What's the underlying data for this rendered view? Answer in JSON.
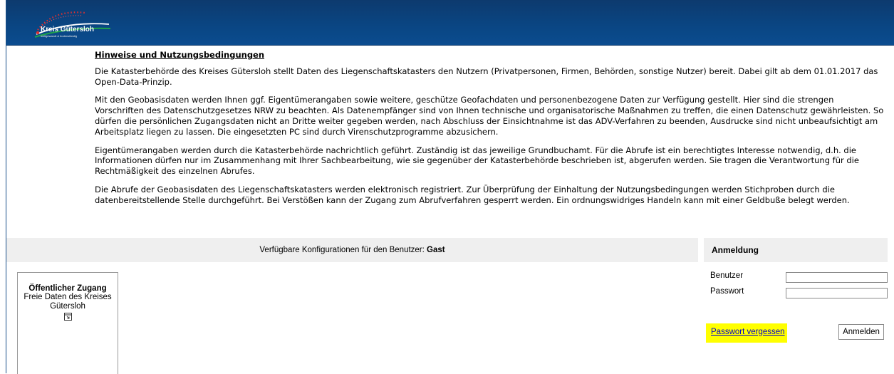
{
  "header": {
    "logo_name": "Kreis Gütersloh",
    "logo_tagline": "weltgewandt & bodenständig",
    "background_color": "#0b4a8c"
  },
  "terms": {
    "title": "Hinweise und Nutzungsbedingungen",
    "paragraphs": [
      "Die Katasterbehörde des Kreises Gütersloh stellt Daten des Liegenschaftskatasters den Nutzern (Privatpersonen, Firmen, Behörden, sonstige Nutzer) bereit. Dabei gilt ab dem 01.01.2017 das Open-Data-Prinzip.",
      "Mit den Geobasisdaten werden Ihnen ggf. Eigentümerangaben sowie weitere, geschütze Geofachdaten und personenbezogene Daten zur Verfügung gestellt. Hier sind die strengen Vorschriften des Datenschutzgesetzes NRW zu beachten. Als Datenempfänger sind von Ihnen technische und organisatorische Maßnahmen zu treffen, die einen Datenschutz gewährleisten. So dürfen die persönlichen Zugangsdaten nicht an Dritte weiter gegeben werden, nach Abschluss der Einsichtnahme ist das ADV-Verfahren zu beenden, Ausdrucke sind nicht unbeaufsichtigt am Arbeitsplatz liegen zu lassen. Die eingesetzten PC sind durch Virenschutzprogramme abzusichern.",
      "Eigentümerangaben werden durch die Katasterbehörde nachrichtlich geführt. Zuständig ist das jeweilige Grundbuchamt. Für die Abrufe ist ein berechtigtes Interesse notwendig, d.h. die Informationen dürfen nur im Zusammenhang mit Ihrer Sachbearbeitung, wie sie gegenüber der Katasterbehörde beschrieben ist, abgerufen werden. Sie tragen die Verantwortung für die Rechtmäßigkeit des einzelnen Abrufes.",
      "Die Abrufe der Geobasisdaten des Liegenschaftskatasters werden elektronisch registriert. Zur Überprüfung der Einhaltung der Nutzungsbedingungen werden Stichproben durch die datenbereitstellende Stelle durchgeführt. Bei Verstößen kann der Zugang zum Abrufverfahren gesperrt werden. Ein ordnungswidriges Handeln kann mit einer Geldbuße belegt werden."
    ]
  },
  "configurations": {
    "label": "Verfügbare Konfigurationen für den Benutzer:",
    "user": "Gast",
    "card": {
      "title": "Öffentlicher Zugang",
      "subtitle": "Freie Daten des Kreises Gütersloh",
      "icon": "window-link-icon"
    }
  },
  "login": {
    "title": "Anmeldung",
    "user_label": "Benutzer",
    "user_value": "",
    "password_label": "Passwort",
    "password_value": "",
    "forgot_label": "Passwort vergessen",
    "submit_label": "Anmelden",
    "highlight_color": "#ffff00"
  }
}
